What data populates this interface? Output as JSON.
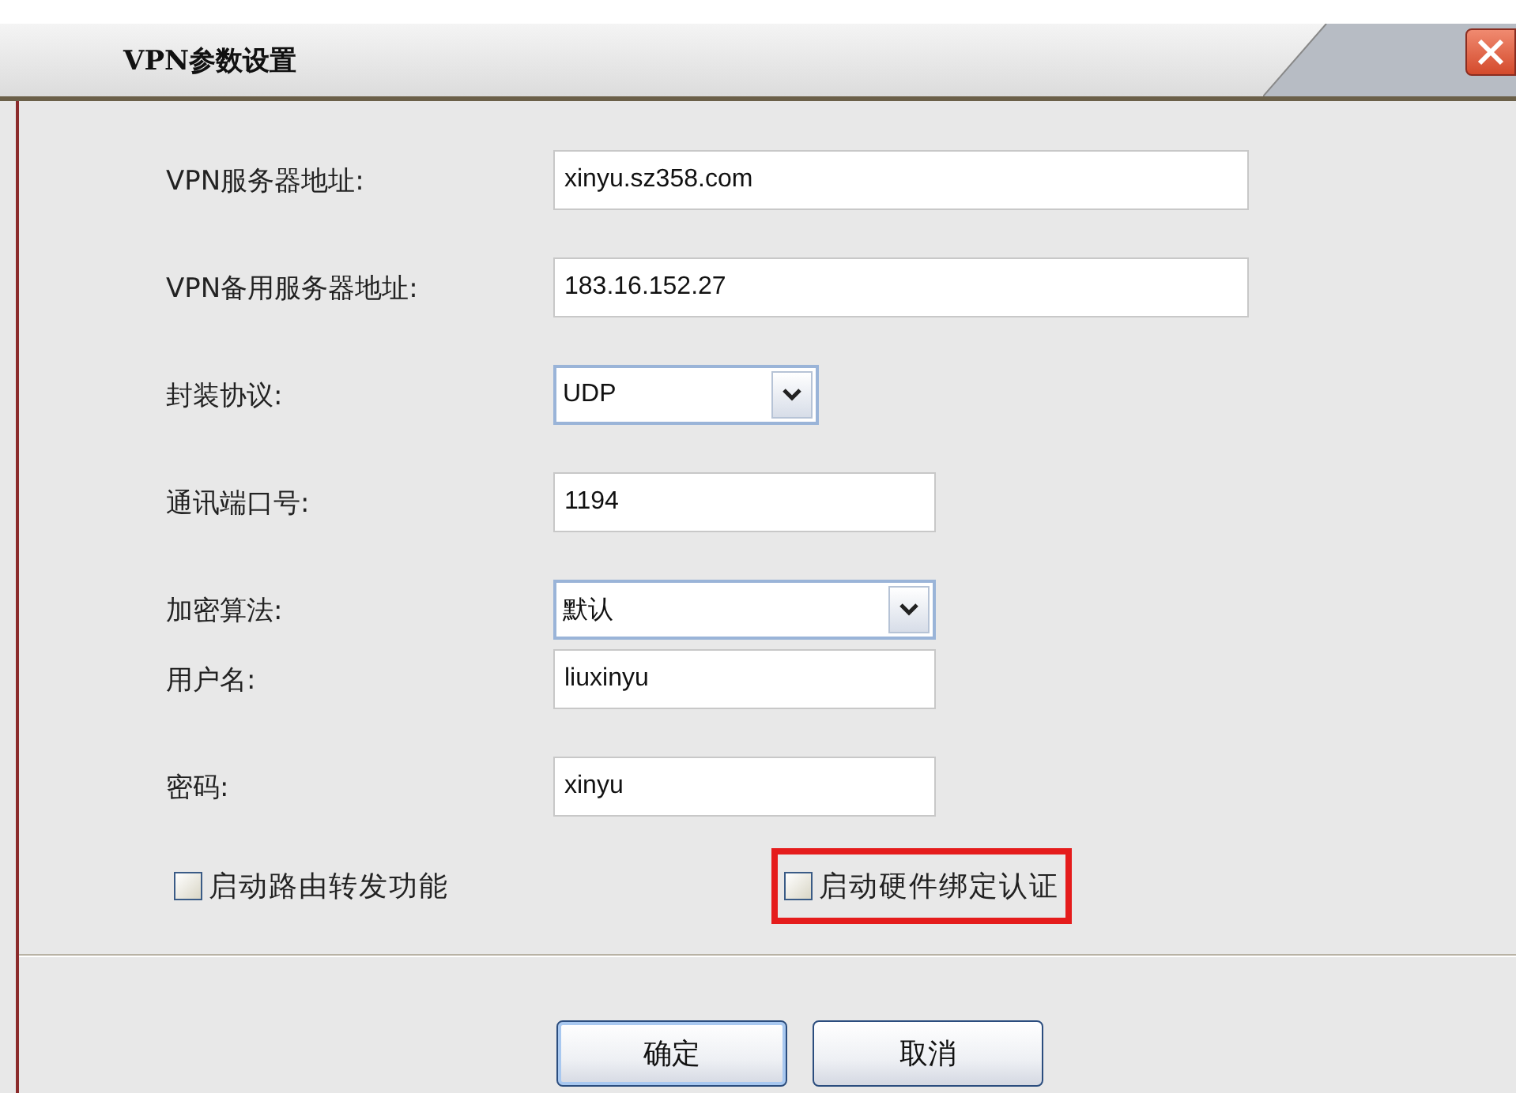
{
  "window": {
    "title": "VPN参数设置"
  },
  "fields": [
    {
      "label": "VPN服务器地址:",
      "kind": "text",
      "value": "xinyu.sz358.com"
    },
    {
      "label": "VPN备用服务器地址:",
      "kind": "text",
      "value": "183.16.152.27"
    },
    {
      "label": "封装协议:",
      "kind": "select",
      "value": "UDP"
    },
    {
      "label": "通讯端口号:",
      "kind": "text",
      "value": "1194"
    },
    {
      "label": "加密算法:",
      "kind": "select",
      "value": "默认"
    },
    {
      "label": "用户名:",
      "kind": "text",
      "value": "liuxinyu"
    },
    {
      "label": "密码:",
      "kind": "text",
      "value": "xinyu"
    }
  ],
  "options": [
    {
      "label": "启动路由转发功能",
      "checked": false,
      "highlighted": false
    },
    {
      "label": "启动硬件绑定认证",
      "checked": false,
      "highlighted": true
    }
  ],
  "buttons": [
    {
      "label": "确定",
      "default": true
    },
    {
      "label": "取消",
      "default": false
    }
  ]
}
